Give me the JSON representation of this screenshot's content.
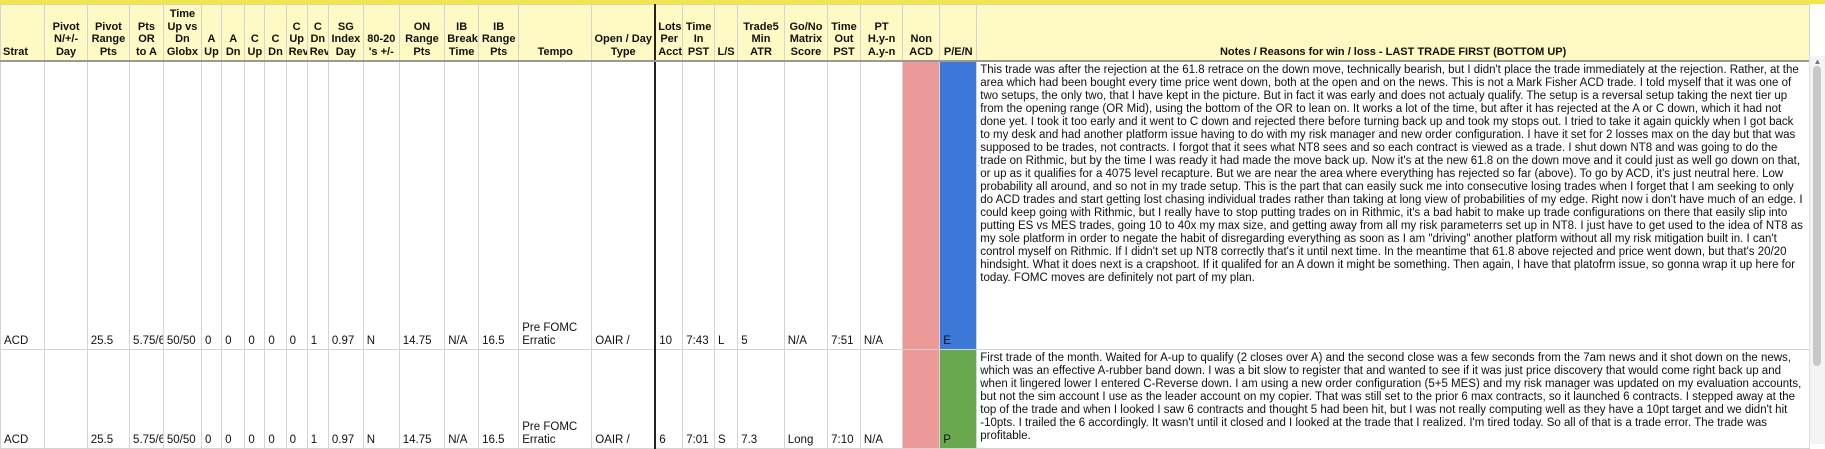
{
  "headers": {
    "strat": "Strat",
    "pivot_nday": "Pivot N/+/- Day",
    "pivot_range": "Pivot Range Pts",
    "pts_or_a": "Pts OR to A",
    "time_up_dn": "Time Up vs Dn Globx",
    "a_up": "A Up",
    "a_dn": "A Dn",
    "c_up": "C Up",
    "c_dn": "C Dn",
    "c_up_rev": "C Up Rev",
    "c_dn_rev": "C Dn Rev",
    "sg_index": "SG Index Day",
    "eighty_twenty": "80-20 's +/-",
    "on_range": "ON Range Pts",
    "ib_break": "IB Break Time",
    "ib_range": "IB Range Pts",
    "tempo": "Tempo",
    "open_day": "Open / Day Type",
    "lots": "Lots Per Acct",
    "time_in": "Time In PST",
    "ls": "L/S",
    "atr": "Trade5 Min ATR",
    "gonogo": "Go/No Matrix Score",
    "time_out": "Time Out PST",
    "pt": "PT H.y-n A.y-n",
    "nonacd": "Non ACD",
    "pen": "P/E/N",
    "notes": "Notes / Reasons for win / loss - LAST TRADE FIRST (BOTTOM UP)"
  },
  "rows": [
    {
      "strat": "ACD",
      "pivot_nday": "",
      "pivot_range": "25.5",
      "pts_or_a": "5.75/6",
      "time_up_dn": "50/50",
      "a_up": "0",
      "a_dn": "0",
      "c_up": "0",
      "c_dn": "0",
      "c_up_rev": "0",
      "c_dn_rev": "1",
      "sg_index": "0.97",
      "eighty_twenty": "N",
      "on_range": "14.75",
      "ib_break": "N/A",
      "ib_range": "16.5",
      "tempo": "Pre FOMC Erratic",
      "open_day": "OAIR /",
      "lots": "10",
      "time_in": "7:43",
      "ls": "L",
      "atr": "5",
      "gonogo": "N/A",
      "time_out": "7:51",
      "pt": "N/A",
      "nonacd": "",
      "pen": "E",
      "nonacd_color": "#eb9999",
      "pen_color": "#3c78d8",
      "notes": "This trade was after the rejection at the 61.8 retrace on the down move, technically bearish, but I didn't place the trade immediately at the rejection. Rather, at the area which had been bought every time price went down, both at the open and on the news. This is not a Mark Fisher ACD trade. I told myself that it was one of two setups, the only two, that I have kept in the picture. But in fact it was early and does not actualy qualify. The setup is a reversal setup taking the next tier up from the opening range (OR Mid), using the bottom of the OR to lean on. It works a lot of the time, but after it has rejected at the A or C down, which it had not done yet. I took it too early and it went to C down and rejected there before turning back up and took my stops out. I tried to take it again quickly when I got back to my desk and had another platform issue having to do with my risk manager and new order configuration. I have it set for 2 losses max on the day but that was supposed to be trades, not contracts. I forgot that it sees what NT8 sees and so each contract is viewed as a trade. I shut down NT8 and was going to do the trade on Rithmic, but by the time I was ready it had made the move back up. Now it's at the new 61.8 on the down move and it could just as well go down on that, or up as it qualifies for a 4075 level recapture. But we are near the area where everything has rejected so far (above). To go by ACD, it's just neutral here. Low probability all around, and so not in my trade setup. This is the part that can easily suck me into consecutive losing trades when I forget that I am seeking to only do ACD trades and start getting lost chasing individual trades rather than taking at long view of probabilities of my edge. Right now i don't have much of an edge. I could keep going with Rithmic, but I really have to stop putting trades on in Rithmic, it's a bad habit to make up trade configurations on there that easily slip into putting ES vs MES trades, going 10 to 40x my max size, and getting away from all my risk parameterrs set up in NT8. I just have to get used to the idea of NT8 as my sole platform in order to negate the habit of disregarding everything as soon as I am \"driving\" another platform without all my risk mitigation built in. I can't control myself on Rithmic. If I didn't set up NT8 correctly that's it until next time. In the meantime that 61.8 above rejected and price went down, but that's 20/20 hindsight. What it does next is a crapshoot. If it qualifed for an A down it might be something. Then again, I have that platofrm issue, so gonna wrap it up here for today. FOMC moves are definitely not part of my plan."
    },
    {
      "strat": "ACD",
      "pivot_nday": "",
      "pivot_range": "25.5",
      "pts_or_a": "5.75/6",
      "time_up_dn": "50/50",
      "a_up": "0",
      "a_dn": "0",
      "c_up": "0",
      "c_dn": "0",
      "c_up_rev": "0",
      "c_dn_rev": "1",
      "sg_index": "0.97",
      "eighty_twenty": "N",
      "on_range": "14.75",
      "ib_break": "N/A",
      "ib_range": "16.5",
      "tempo": "Pre FOMC Erratic",
      "open_day": "OAIR /",
      "lots": "6",
      "time_in": "7:01",
      "ls": "S",
      "atr": "7.3",
      "gonogo": "Long",
      "time_out": "7:10",
      "pt": "N/A",
      "nonacd": "",
      "pen": "P",
      "nonacd_color": "#eb9999",
      "pen_color": "#6aa84f",
      "notes": "First trade of the month. Waited for A-up to qualify (2 closes over A) and the second close was a few seconds from the 7am news and it shot down on the news, which was an effective A-rubber band down. I was a bit slow to register that and wanted to see if it was just price discovery that would come right back up and when it lingered lower I entered C-Reverse down. I am using a new order configuration (5+5 MES) and my risk manager was updated on my evaluation accounts, but not the sim account I use as the leader account on my copier. That was still set to the prior 6 max contracts, so it launched 6 contracts. I stepped away at the top of the trade and when I looked I saw 6 contracts and thought 5 had been hit, but I was not really computing well as they have a 10pt target and we didn't hit -10pts. I trailed the 6 accordingly. It wasn't until it closed and I looked at the trade that I realized. I'm tired today. So all of that is a trade error. The trade was profitable."
    }
  ]
}
